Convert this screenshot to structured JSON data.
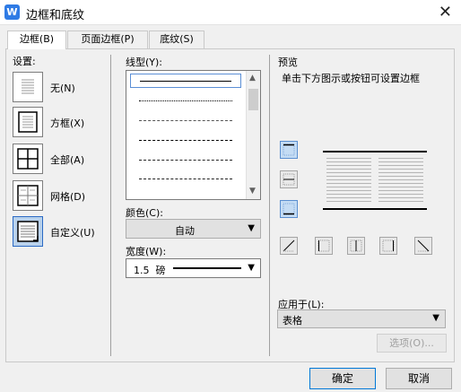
{
  "window": {
    "title": "边框和底纹",
    "app_icon_glyph": "W"
  },
  "tabs": [
    {
      "label": "边框(B)",
      "active": true
    },
    {
      "label": "页面边框(P)",
      "active": false
    },
    {
      "label": "底纹(S)",
      "active": false
    }
  ],
  "settings": {
    "heading": "设置:",
    "items": [
      {
        "label": "无(N)",
        "icon": "no-border-icon"
      },
      {
        "label": "方框(X)",
        "icon": "box-border-icon"
      },
      {
        "label": "全部(A)",
        "icon": "all-borders-icon"
      },
      {
        "label": "网格(D)",
        "icon": "grid-border-icon"
      },
      {
        "label": "自定义(U)",
        "icon": "custom-border-icon",
        "selected": true
      }
    ]
  },
  "line_style": {
    "heading": "线型(Y):",
    "selected_index": 0
  },
  "color": {
    "heading": "颜色(C):",
    "value": "自动"
  },
  "width": {
    "heading": "宽度(W):",
    "value": "1.5  磅"
  },
  "preview": {
    "heading": "预览",
    "hint": "单击下方图示或按钮可设置边框"
  },
  "apply_to": {
    "heading": "应用于(L):",
    "value": "表格"
  },
  "buttons": {
    "options": "选项(O)...",
    "ok": "确定",
    "cancel": "取消"
  },
  "colors": {
    "accent": "#0078d7",
    "selected_fill": "#b9d2ec"
  }
}
